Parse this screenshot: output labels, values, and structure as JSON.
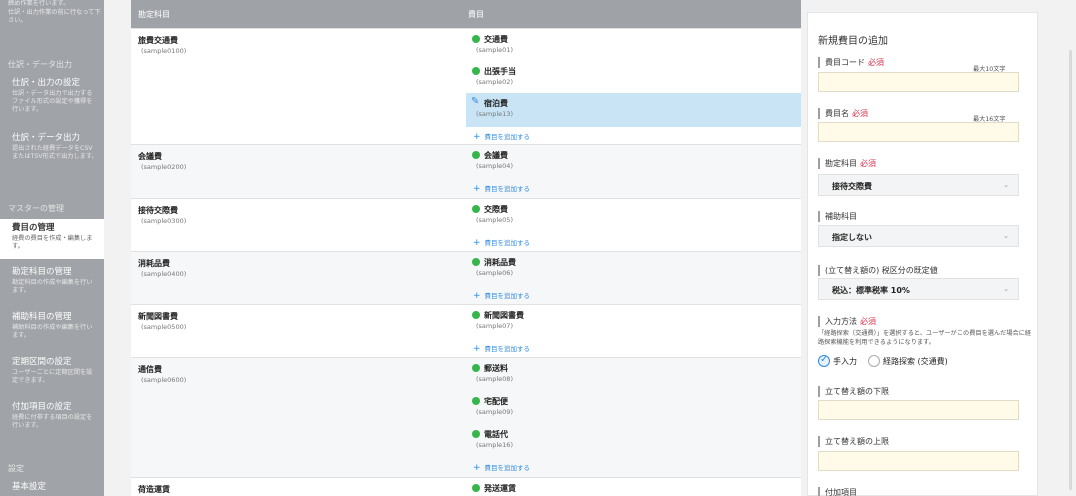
{
  "sidebar": {
    "top_text": "締め作業を行います。\n仕訳・出力作業の前に行なって下さい。",
    "section_journal": "仕訳・データ出力",
    "section_master": "マスターの管理",
    "section_settings": "設定",
    "items": [
      {
        "title": "仕訳・出力の設定",
        "desc": "仕訳・データ出力で出力するファイル形式の設定や獲得を行います。"
      },
      {
        "title": "仕訳・データ出力",
        "desc": "提出された経費データをCSVまたはTSV形式で出力します。"
      },
      {
        "title": "費目の管理",
        "desc": "経費の費目を作成・編集します。"
      },
      {
        "title": "勘定科目の管理",
        "desc": "勘定科目の作成や編集を行います。"
      },
      {
        "title": "補助科目の管理",
        "desc": "補助科目の作成や編集を行います。"
      },
      {
        "title": "定期区間の設定",
        "desc": "ユーザーごとに定期区間を設定できます。"
      },
      {
        "title": "付加項目の設定",
        "desc": "経費に付帯する項目の設定を行います。"
      },
      {
        "title": "基本設定",
        "desc": ""
      }
    ]
  },
  "table": {
    "col_account": "勘定科目",
    "col_expense": "費目",
    "add_link": "費目を追加する",
    "rows": [
      {
        "name": "旅費交通費",
        "code": "(sample0100)",
        "expenses": [
          {
            "name": "交通費",
            "code": "(sample01)",
            "selected": false
          },
          {
            "name": "出張手当",
            "code": "(sample02)",
            "selected": false
          },
          {
            "name": "宿泊費",
            "code": "(sample13)",
            "selected": true
          }
        ]
      },
      {
        "name": "会議費",
        "code": "(sample0200)",
        "expenses": [
          {
            "name": "会議費",
            "code": "(sample04)",
            "selected": false
          }
        ]
      },
      {
        "name": "接待交際費",
        "code": "(sample0300)",
        "expenses": [
          {
            "name": "交際費",
            "code": "(sample05)",
            "selected": false
          }
        ]
      },
      {
        "name": "消耗品費",
        "code": "(sample0400)",
        "expenses": [
          {
            "name": "消耗品費",
            "code": "(sample06)",
            "selected": false
          }
        ]
      },
      {
        "name": "新聞図書費",
        "code": "(sample0500)",
        "expenses": [
          {
            "name": "新聞図書費",
            "code": "(sample07)",
            "selected": false
          }
        ]
      },
      {
        "name": "通信費",
        "code": "(sample0600)",
        "expenses": [
          {
            "name": "郵送料",
            "code": "(sample08)",
            "selected": false
          },
          {
            "name": "宅配便",
            "code": "(sample09)",
            "selected": false
          },
          {
            "name": "電話代",
            "code": "(sample16)",
            "selected": false
          }
        ]
      },
      {
        "name": "荷造運賃",
        "code": "",
        "expenses": [
          {
            "name": "発送運賃",
            "code": "",
            "selected": false
          }
        ]
      }
    ]
  },
  "panel": {
    "title": "新規費目の追加",
    "required": "必須",
    "code_label": "費目コード",
    "code_hint": "最大10文字",
    "name_label": "費目名",
    "name_hint": "最大16文字",
    "account_label": "勘定科目",
    "account_value": "接待交際費",
    "subaccount_label": "補助科目",
    "subaccount_value": "指定しない",
    "tax_label": "(立て替え額の) 税区分の既定値",
    "tax_value": "税込：標準税率 10%",
    "input_method_label": "入力方法",
    "input_method_desc": "「経路探索（交通費）」を選択すると、ユーザーがこの費目を選んだ場合に経路探索機能を利用できるようになります。",
    "radio_manual": "手入力",
    "radio_route": "経路探索 (交通費)",
    "lower_limit_label": "立て替え額の下限",
    "upper_limit_label": "立て替え額の上限",
    "extra_label": "付加項目"
  }
}
